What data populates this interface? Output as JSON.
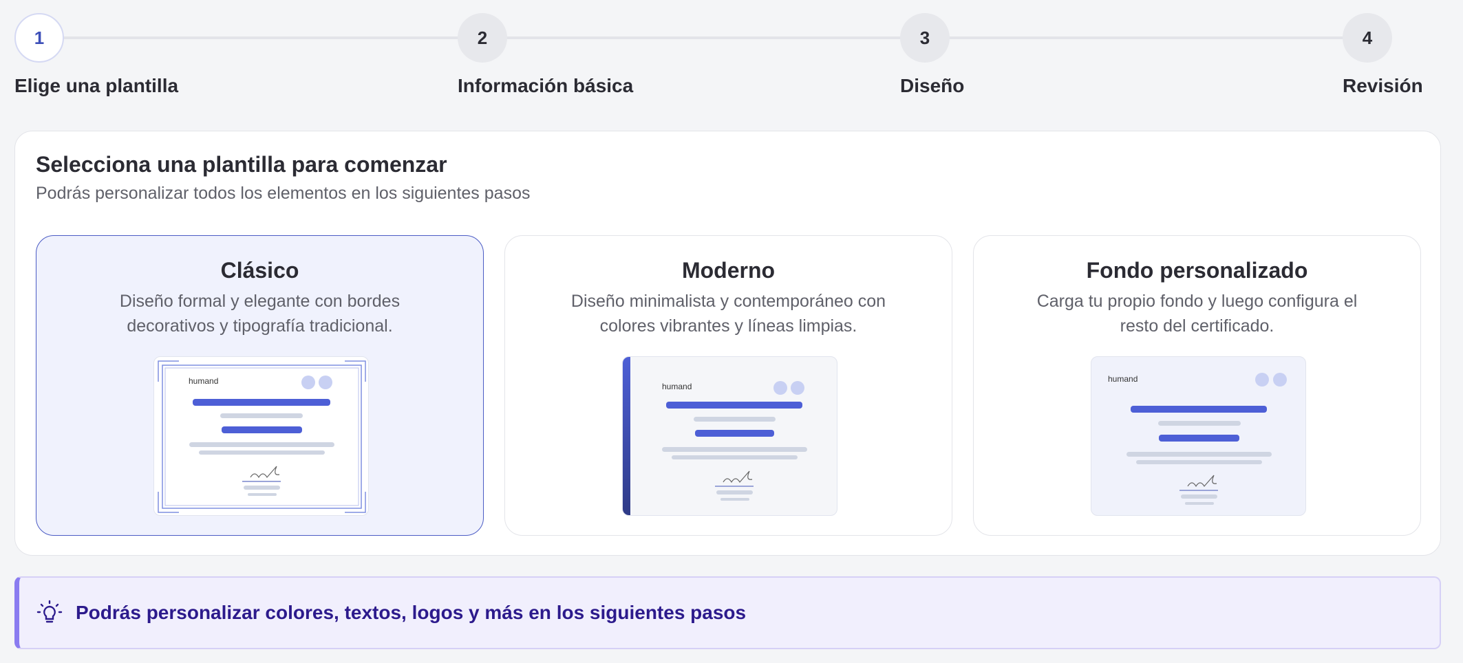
{
  "stepper": {
    "steps": [
      {
        "number": "1",
        "label": "Elige una plantilla",
        "active": true
      },
      {
        "number": "2",
        "label": "Información básica",
        "active": false
      },
      {
        "number": "3",
        "label": "Diseño",
        "active": false
      },
      {
        "number": "4",
        "label": "Revisión",
        "active": false
      }
    ]
  },
  "main": {
    "title": "Selecciona una plantilla para comenzar",
    "subtitle": "Podrás personalizar todos los elementos en los siguientes pasos",
    "templates": [
      {
        "name": "Clásico",
        "description": "Diseño formal y elegante con bordes decorativos y tipografía tradicional.",
        "selected": true,
        "brand": "humand"
      },
      {
        "name": "Moderno",
        "description": "Diseño minimalista y contemporáneo con colores vibrantes y líneas limpias.",
        "selected": false,
        "brand": "humand"
      },
      {
        "name": "Fondo personalizado",
        "description": "Carga tu propio fondo y luego configura el resto del certificado.",
        "selected": false,
        "brand": "humand"
      }
    ]
  },
  "tip": {
    "icon": "lightbulb-icon",
    "text": "Podrás personalizar colores, textos, logos y más en los siguientes pasos"
  },
  "colors": {
    "accent": "#4a5bc4",
    "bar": "#4d5fd6",
    "tip_text": "#2c1a8c",
    "tip_border": "#8a7cf0"
  }
}
